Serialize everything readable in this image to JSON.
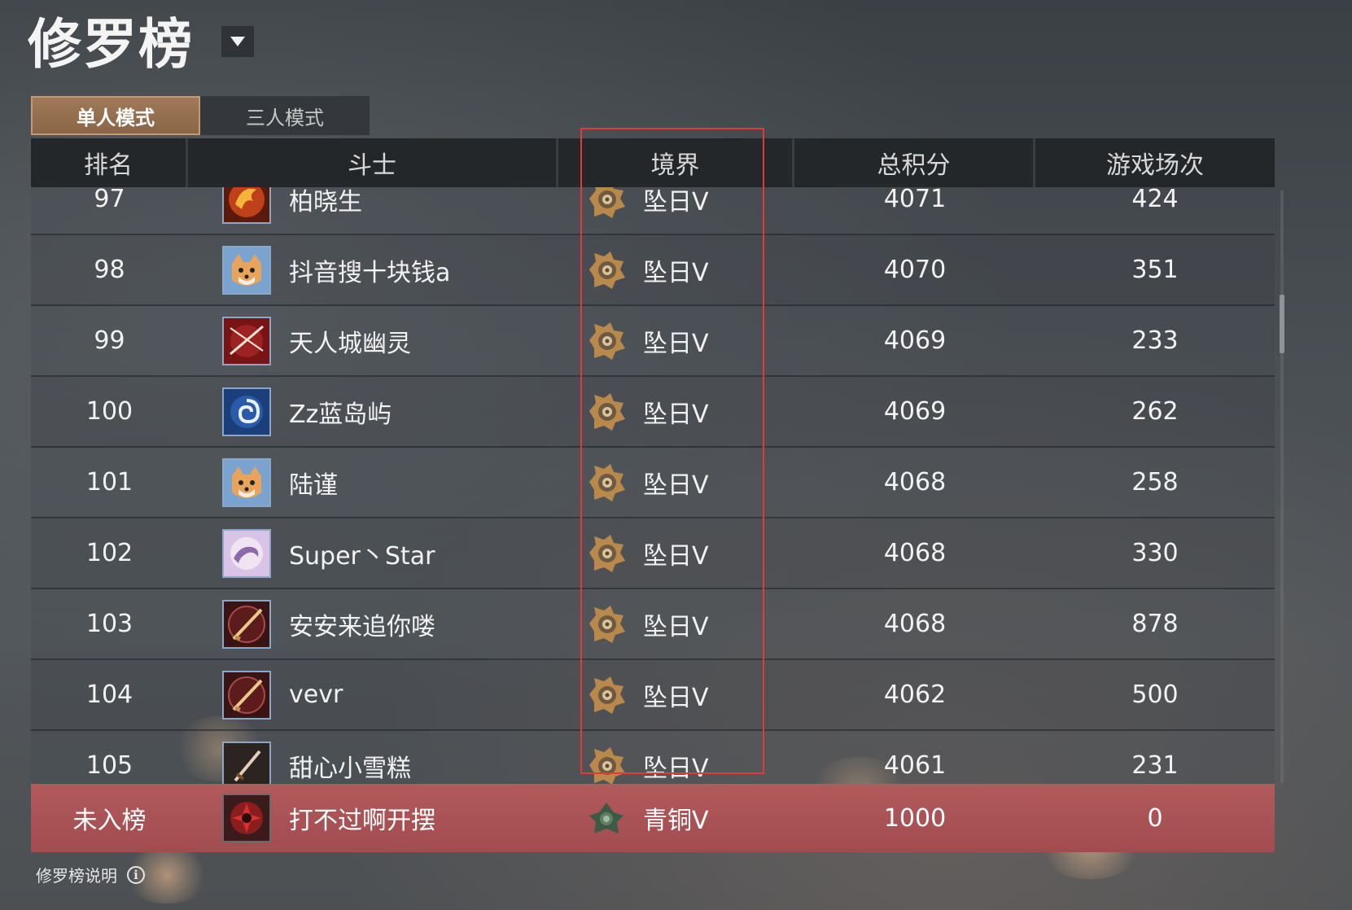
{
  "title": "修罗榜",
  "tabs": [
    {
      "label": "单人模式",
      "active": true
    },
    {
      "label": "三人模式",
      "active": false
    }
  ],
  "headers": {
    "rank": "排名",
    "fighter": "斗士",
    "realm": "境界",
    "score": "总积分",
    "games": "游戏场次"
  },
  "rows": [
    {
      "rank": "97",
      "name": "柏晓生",
      "realm": "坠日Ⅴ",
      "score": "4071",
      "games": "424",
      "avatar": "dragon-avatar"
    },
    {
      "rank": "98",
      "name": "抖音搜十块钱a",
      "realm": "坠日Ⅴ",
      "score": "4070",
      "games": "351",
      "avatar": "shiba-avatar"
    },
    {
      "rank": "99",
      "name": "天人城幽灵",
      "realm": "坠日Ⅴ",
      "score": "4069",
      "games": "233",
      "avatar": "crossed-blades-avatar"
    },
    {
      "rank": "100",
      "name": "Zz蓝岛屿",
      "realm": "坠日Ⅴ",
      "score": "4069",
      "games": "262",
      "avatar": "swirl-avatar"
    },
    {
      "rank": "101",
      "name": "陆谨",
      "realm": "坠日Ⅴ",
      "score": "4068",
      "games": "258",
      "avatar": "shiba-avatar"
    },
    {
      "rank": "102",
      "name": "Super丶Star",
      "realm": "坠日Ⅴ",
      "score": "4068",
      "games": "330",
      "avatar": "dragon-moon-avatar"
    },
    {
      "rank": "103",
      "name": "安安来追你喽",
      "realm": "坠日Ⅴ",
      "score": "4068",
      "games": "878",
      "avatar": "musket-avatar"
    },
    {
      "rank": "104",
      "name": "vevr",
      "realm": "坠日Ⅴ",
      "score": "4062",
      "games": "500",
      "avatar": "musket-avatar"
    },
    {
      "rank": "105",
      "name": "甜心小雪糕",
      "realm": "坠日Ⅴ",
      "score": "4061",
      "games": "231",
      "avatar": "dagger-avatar"
    }
  ],
  "my_row": {
    "rank": "未入榜",
    "name": "打不过啊开摆",
    "realm": "青铜Ⅴ",
    "score": "1000",
    "games": "0",
    "avatar": "red-emblem-avatar"
  },
  "footer": {
    "label": "修罗榜说明",
    "info_icon": "i"
  },
  "colors": {
    "active_tab": "#a07a58",
    "my_row": "#a84f52",
    "highlight_box": "#e23a3a",
    "header_bg": "#24272a"
  }
}
